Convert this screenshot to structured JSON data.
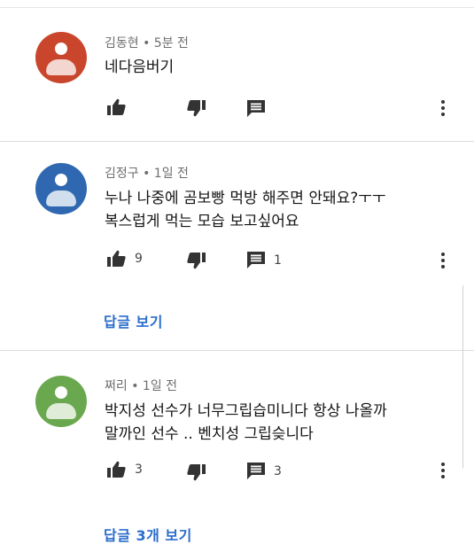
{
  "comments": [
    {
      "author": "김동현",
      "time": "• 5분 전",
      "lines": [
        "네다음버기"
      ],
      "likes": "",
      "replies_count": "",
      "avatar_color": "#c9452c",
      "view_replies": ""
    },
    {
      "author": "김정구",
      "time": "• 1일 전",
      "lines": [
        "누나 나중에 곰보빵 먹방 해주면 안돼요?ㅜㅜ",
        "복스럽게 먹는 모습 보고싶어요"
      ],
      "likes": "9",
      "replies_count": "1",
      "avatar_color": "#2f68b0",
      "view_replies": "답글 보기"
    },
    {
      "author": "쩌리",
      "time": "• 1일 전",
      "lines": [
        "박지성 선수가 너무그립습미니다 항상 나올까",
        "말까인 선수 .. 벤치성 그립슺니다"
      ],
      "likes": "3",
      "replies_count": "3",
      "avatar_color": "#6aa84f",
      "view_replies": "답글 3개 보기"
    }
  ],
  "icons": {
    "like": "thumbs-up-icon",
    "dislike": "thumbs-down-icon",
    "reply": "comment-icon",
    "more": "more-vert-icon"
  },
  "colors": {
    "link": "#2a6dcc",
    "meta": "#6e6e6e"
  }
}
